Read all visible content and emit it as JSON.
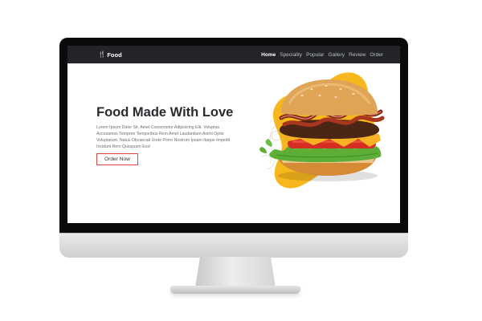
{
  "navbar": {
    "brand": {
      "icon": "fork-knife-icon",
      "icon_glyph": "🍴",
      "label": "Food"
    },
    "links": [
      {
        "label": "Home",
        "active": true
      },
      {
        "label": "Speciality",
        "active": false
      },
      {
        "label": "Popular",
        "active": false
      },
      {
        "label": "Gallery",
        "active": false
      },
      {
        "label": "Review",
        "active": false
      },
      {
        "label": "Order",
        "active": false
      }
    ]
  },
  "hero": {
    "title": "Food Made With Love",
    "description": "Lorem Ipsum Dolor Sit, Amet Consectetur Adipisicing Elit. Voluptas Accusamus Tempore Temporibus Rem Amet Laudantium Animi Optio Voluptatum. Natus Obcaecati Unde Porro Nostrum Ipsam Itaque Impedit Incidunt Rem Quisquam Eos!",
    "button_label": "Order Now"
  },
  "colors": {
    "accent": "#e0463f",
    "navbar_bg": "#232427",
    "blob_yellow": "#f6b81c"
  }
}
